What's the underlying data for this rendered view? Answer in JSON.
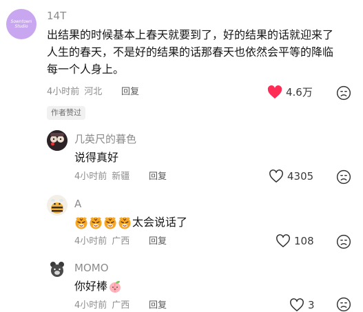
{
  "comments": [
    {
      "author": "14T",
      "avatar_text": "Sowntown Studio",
      "text": "出结果的时候基本上春天就要到了，好的结果的话就迎来了人生的春天，不是好的结果的话那春天也依然会平等的降临每一个人身上。",
      "time": "4小时前",
      "location": "河北",
      "reply_label": "回复",
      "likes": "4.6万",
      "liked": true,
      "badge": "作者赞过"
    },
    {
      "author": "几英尺的暮色",
      "text": "说得真好",
      "time": "4小时前",
      "location": "新疆",
      "reply_label": "回复",
      "likes": "4305"
    },
    {
      "author": "A",
      "text": "太会说话了",
      "emoji_icons": [
        "tiger-face-emoji",
        "tiger-face-emoji",
        "tiger-face-emoji",
        "tiger-face-emoji"
      ],
      "time": "4小时前",
      "location": "广西",
      "reply_label": "回复",
      "likes": "108"
    },
    {
      "author": "MOMO",
      "text": "你好棒",
      "emoji_icons": [
        "peach-emoji"
      ],
      "time": "4小时前",
      "location": "广西",
      "reply_label": "回复",
      "likes": "3"
    }
  ],
  "colors": {
    "liked_heart": "#ff2d55",
    "avatar_purple": "#c9a6f0",
    "name_gray": "#8b8b8b",
    "meta_gray": "#8e8e8e"
  },
  "icons": {
    "like": "heart-outline-icon",
    "liked": "heart-filled-icon",
    "dislike": "sad-face-icon"
  }
}
